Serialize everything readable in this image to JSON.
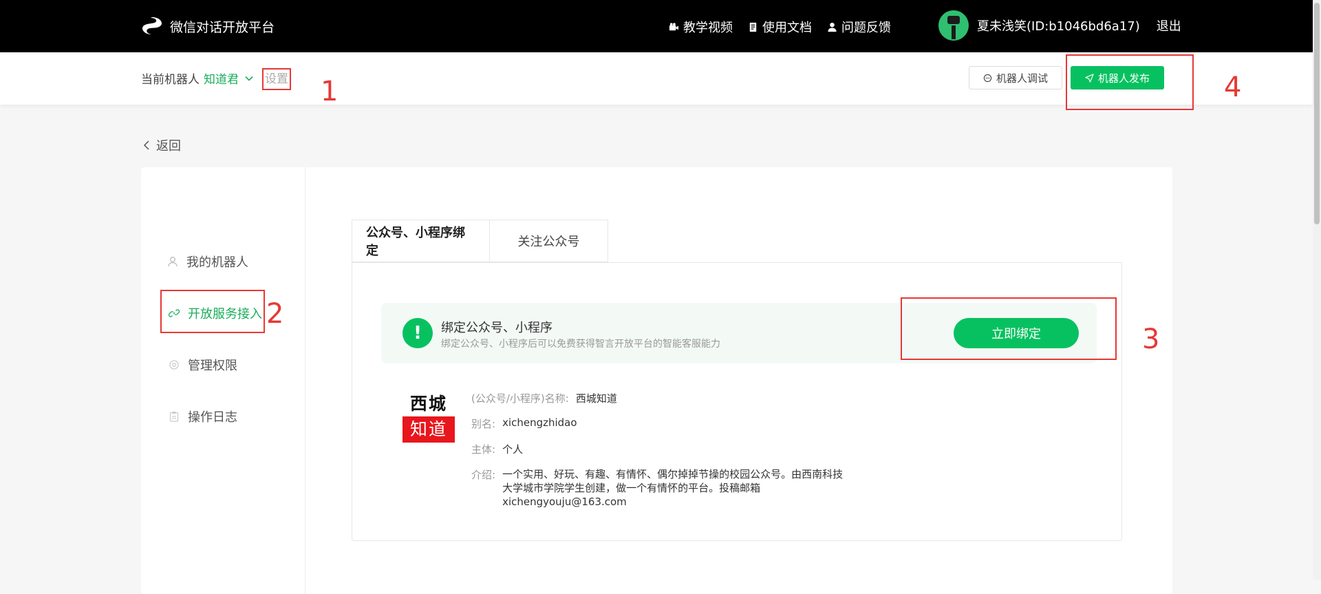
{
  "header": {
    "brand": "微信对话开放平台",
    "nav": [
      {
        "label": "教学视频",
        "icon": "video-camera-icon"
      },
      {
        "label": "使用文档",
        "icon": "document-icon"
      },
      {
        "label": "问题反馈",
        "icon": "user-icon"
      }
    ],
    "user_name": "夏未浅笑(ID:b1046bd6a17)",
    "logout": "退出"
  },
  "subbar": {
    "current_label": "当前机器人",
    "current_bot": "知道君",
    "settings": "设置",
    "debug_button": "机器人调试",
    "publish_button": "机器人发布"
  },
  "back": "返回",
  "sidebar": {
    "items": [
      {
        "label": "我的机器人",
        "icon": "user-icon"
      },
      {
        "label": "开放服务接入",
        "icon": "link-icon",
        "active": true
      },
      {
        "label": "管理权限",
        "icon": "gear-icon"
      },
      {
        "label": "操作日志",
        "icon": "clipboard-icon"
      }
    ]
  },
  "tabs": [
    "公众号、小程序绑定",
    "关注公众号"
  ],
  "banner": {
    "title": "绑定公众号、小程序",
    "subtitle": "绑定公众号、小程序后可以免费获得智言开放平台的智能客服能力",
    "button": "立即绑定"
  },
  "account": {
    "logo_top": "西城",
    "logo_bottom": "知道",
    "name_label": "(公众号/小程序)名称:",
    "name": "西城知道",
    "alias_label": "别名:",
    "alias": "xichengzhidao",
    "owner_label": "主体:",
    "owner": "个人",
    "intro_label": "介绍:",
    "intro": "一个实用、好玩、有趣、有情怀、偶尔掉掉节操的校园公众号。由西南科技大学城市学院学生创建，做一个有情怀的平台。投稿邮箱xichengyouju@163.com"
  },
  "annotations": [
    "1",
    "2",
    "3",
    "4"
  ],
  "colors": {
    "accent": "#07c160",
    "annotation": "#e53935"
  }
}
